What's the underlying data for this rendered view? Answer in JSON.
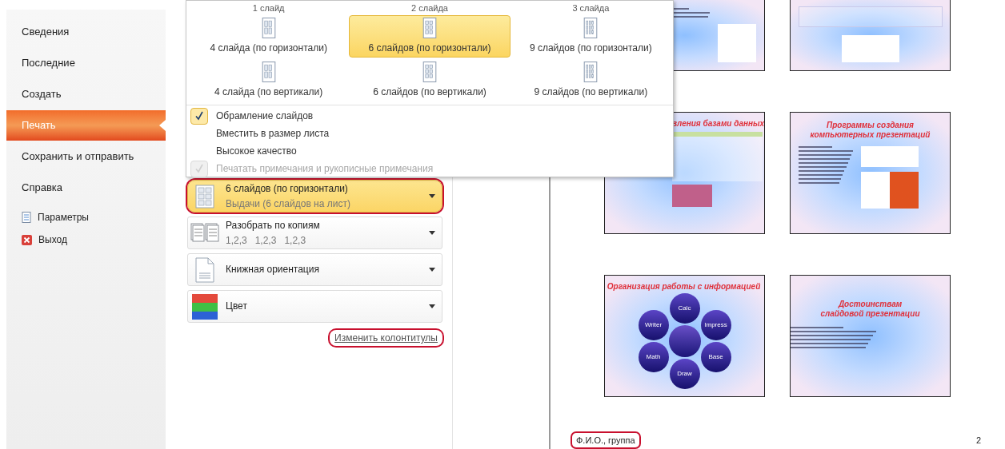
{
  "sidebar": {
    "items": [
      {
        "label": "Сведения",
        "kind": "tab",
        "selected": false
      },
      {
        "label": "Последние",
        "kind": "tab",
        "selected": false
      },
      {
        "label": "Создать",
        "kind": "tab",
        "selected": false
      },
      {
        "label": "Печать",
        "kind": "tab",
        "selected": true
      },
      {
        "label": "Сохранить и отправить",
        "kind": "tab",
        "selected": false
      },
      {
        "label": "Справка",
        "kind": "tab",
        "selected": false
      },
      {
        "label": "Параметры",
        "kind": "options"
      },
      {
        "label": "Выход",
        "kind": "exit"
      }
    ]
  },
  "layout_menu": {
    "column_headers": [
      "1 слайд",
      "2 слайда",
      "3 слайда"
    ],
    "options": [
      {
        "label": "4 слайда (по горизонтали)",
        "selected": false
      },
      {
        "label": "6 слайдов (по горизонтали)",
        "selected": true
      },
      {
        "label": "9 слайдов (по горизонтали)",
        "selected": false
      },
      {
        "label": "4 слайда (по вертикали)",
        "selected": false
      },
      {
        "label": "6 слайдов (по вертикали)",
        "selected": false
      },
      {
        "label": "9 слайдов (по вертикали)",
        "selected": false
      }
    ],
    "checks": [
      {
        "label": "Обрамление слайдов",
        "checked": true,
        "disabled": false
      },
      {
        "label": "Вместить в размер листа",
        "checked": false,
        "disabled": false
      },
      {
        "label": "Высокое качество",
        "checked": false,
        "disabled": false
      },
      {
        "label": "Печатать примечания и рукописные примечания",
        "checked": true,
        "disabled": true
      }
    ]
  },
  "settings": [
    {
      "kind": "handouts",
      "title": "6 слайдов (по горизонтали)",
      "subtitle": "Выдачи (6 слайдов на лист)",
      "highlighted": true,
      "annotated": true
    },
    {
      "kind": "collate",
      "title": "Разобрать по копиям",
      "subtitle": "1,2,3   1,2,3   1,2,3",
      "highlighted": false,
      "annotated": false
    },
    {
      "kind": "orientation",
      "title": "Книжная ориентация",
      "highlighted": false,
      "annotated": false
    },
    {
      "kind": "color",
      "title": "Цвет",
      "highlighted": false,
      "annotated": false
    }
  ],
  "header_footer_link": {
    "label": "Изменить колонтитулы",
    "annotated": true
  },
  "preview": {
    "slides": [
      {
        "kind": "writer"
      },
      {
        "kind": "spreadsheet"
      },
      {
        "kind": "table",
        "title": "вления базами данных"
      },
      {
        "kind": "presentation",
        "title": "Программы создания компьютерных презентаций"
      },
      {
        "kind": "diagram",
        "title": "Организация работы с информацией",
        "nodes": [
          "Calc",
          "Impress",
          "Base",
          "Draw",
          "Math",
          "Writer"
        ]
      },
      {
        "kind": "bullets",
        "title": "Достоинствам слайдовой презентации"
      }
    ],
    "footer": {
      "text": "Ф.И.О., группа",
      "annotated": true
    },
    "page_number": "2"
  }
}
